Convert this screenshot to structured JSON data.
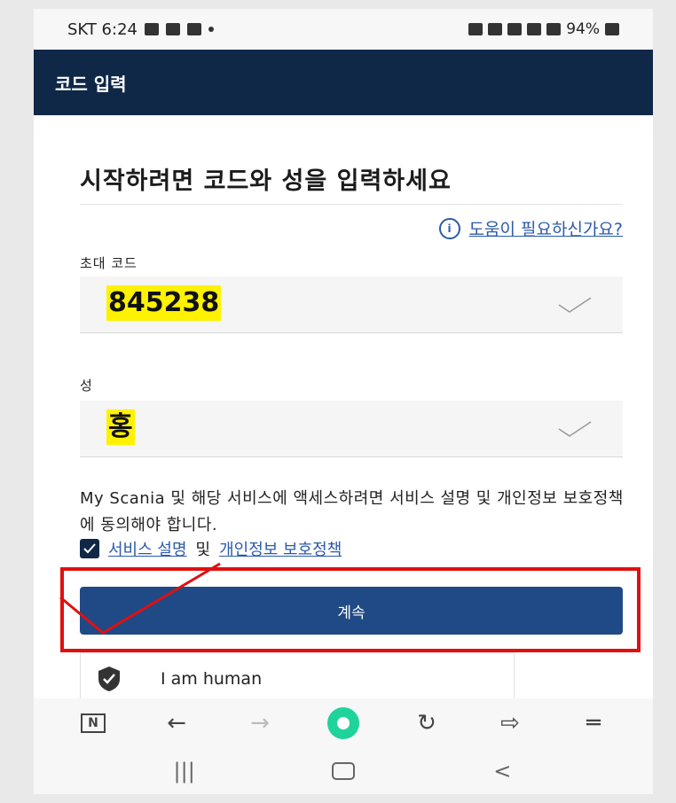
{
  "status_bar": {
    "carrier_time": "SKT 6:24",
    "right_text": "94%"
  },
  "app_bar": {
    "title": "코드 입력"
  },
  "form": {
    "heading": "시작하려면 코드와 성을 입력하세요",
    "help_link": "도움이 필요하신가요?",
    "invite_label": "초대 코드",
    "invite_value": "845238",
    "surname_label": "성",
    "surname_value": "홍",
    "consent_text": "My Scania 및 해당 서비스에 액세스하려면 서비스 설명 및 개인정보 보호정책에 동의해야 합니다.",
    "service_link": "서비스 설명",
    "and_text": "및",
    "privacy_link": "개인정보 보호정책",
    "continue_label": "계속",
    "captcha_label": "I am human"
  },
  "browser_bar": {
    "tab_label": "N"
  },
  "colors": {
    "app_bar_bg": "#0f2848",
    "button_bg": "#1f4a85",
    "highlight": "#fff200",
    "annotation_red": "#e01010"
  }
}
